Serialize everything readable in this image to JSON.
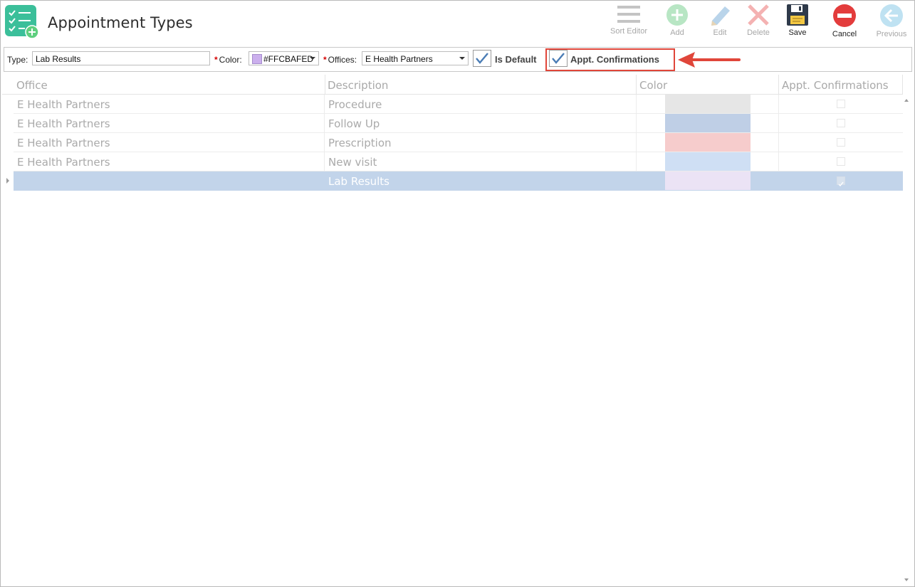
{
  "header": {
    "title": "Appointment Types"
  },
  "toolbar": {
    "sort_editor": "Sort Editor",
    "add": "Add",
    "edit": "Edit",
    "delete": "Delete",
    "save": "Save",
    "cancel": "Cancel",
    "previous": "Previous"
  },
  "form": {
    "type_label": "Type:",
    "type_value": "Lab Results",
    "color_label": "Color:",
    "color_value": "#FFCBAFED",
    "offices_label": "Offices:",
    "offices_value": "E Health Partners",
    "is_default_label": "Is Default",
    "is_default_checked": true,
    "appt_confirmations_label": "Appt. Confirmations",
    "appt_confirmations_checked": true
  },
  "grid": {
    "columns": [
      "Office",
      "Description",
      "Color",
      "Appt. Confirmations"
    ],
    "rows": [
      {
        "office": "E Health Partners",
        "description": "Procedure",
        "color": "#e6e6e6",
        "confirm": false
      },
      {
        "office": "E Health Partners",
        "description": "Follow Up",
        "color": "#bfcfe6",
        "confirm": false
      },
      {
        "office": "E Health Partners",
        "description": "Prescription",
        "color": "#f6cccc",
        "confirm": false
      },
      {
        "office": "E Health Partners",
        "description": "New visit",
        "color": "#cfdff4",
        "confirm": false
      },
      {
        "office": "",
        "description": "Lab Results",
        "color": "#ebe3f5",
        "confirm": true
      }
    ]
  },
  "colors": {
    "accent_red": "#e0463a",
    "selected_row": "#c2d4ea",
    "app_icon": "#3bbf9a"
  }
}
